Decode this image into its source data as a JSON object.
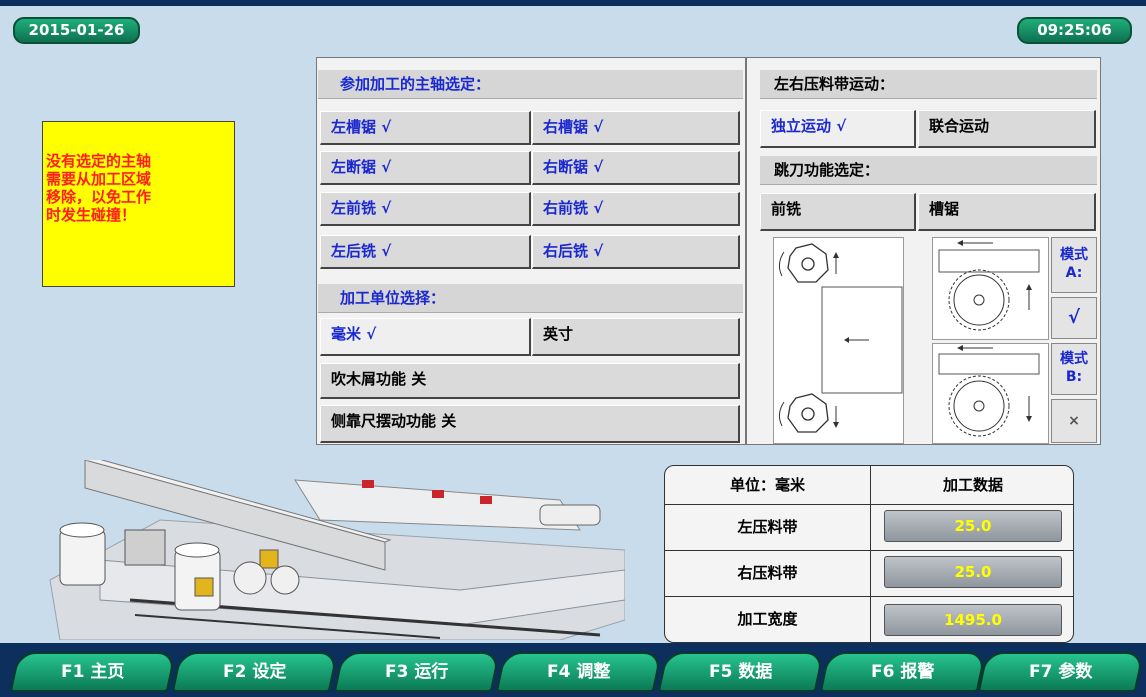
{
  "header": {
    "date": "2015-01-26",
    "time": "09:25:06"
  },
  "warning": {
    "text": "没有选定的主轴\n需要从加工区域\n移除，以免工作\n时发生碰撞！"
  },
  "spindle": {
    "title": "参加加工的主轴选定：",
    "items": [
      "左槽锯  √",
      "右槽锯  √",
      "左断锯  √",
      "右断锯  √",
      "左前铣  √",
      "右前铣  √",
      "左后铣  √",
      "右后铣  √"
    ]
  },
  "unit_select": {
    "title": "加工单位选择：",
    "mm": "毫米  √",
    "inch": "英寸"
  },
  "toggles": {
    "blower": "吹木屑功能 关",
    "side_fence": "侧靠尺摆动功能 关"
  },
  "belt": {
    "title": "左右压料带运动：",
    "independent": "独立运动  √",
    "linked": "联合运动"
  },
  "skip": {
    "title": "跳刀功能选定：",
    "milling": "前铣",
    "saw": "槽锯",
    "mode_a": "模式\nA:",
    "mode_a_mark": "√",
    "mode_b": "模式\nB:",
    "mode_b_mark": "×"
  },
  "table": {
    "header_unit": "单位：毫米",
    "header_data": "加工数据",
    "rows": [
      {
        "label": "左压料带",
        "value": "25.0"
      },
      {
        "label": "右压料带",
        "value": "25.0"
      },
      {
        "label": "加工宽度",
        "value": "1495.0"
      }
    ]
  },
  "fkeys": [
    "F1 主页",
    "F2 设定",
    "F3 运行",
    "F4 调整",
    "F5 数据",
    "F6 报警",
    "F7 参数"
  ],
  "colors": {
    "background": "#c9dcec",
    "accent": "#14946a",
    "selected_text": "#1a28d0",
    "value_text": "#ffff00",
    "warning_bg": "#ffff00",
    "warning_text": "#ff1e1e"
  }
}
